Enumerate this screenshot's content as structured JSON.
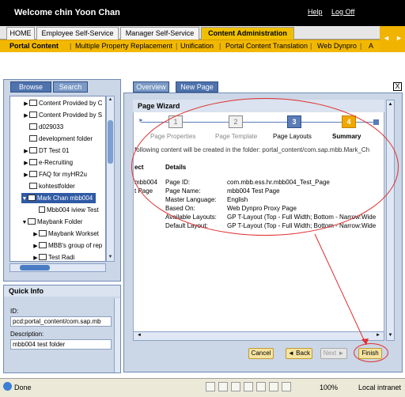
{
  "header": {
    "welcome": "Welcome chin Yoon Chan",
    "help": "Help",
    "logoff": "Log Off"
  },
  "top_tabs": [
    {
      "label": "HOME"
    },
    {
      "label": "Employee Self-Service"
    },
    {
      "label": "Manager Self-Service"
    },
    {
      "label": "Content Administration",
      "active": true
    }
  ],
  "sub_tabs": [
    {
      "label": "Portal Content",
      "active": true
    },
    {
      "label": "Multiple Property Replacement"
    },
    {
      "label": "Unification"
    },
    {
      "label": "Portal Content Translation"
    },
    {
      "label": "Web Dynpro"
    },
    {
      "label": "A"
    }
  ],
  "left": {
    "tabs": [
      {
        "label": "Browse"
      },
      {
        "label": "Search"
      }
    ],
    "tree": [
      {
        "label": "Content Provided by C"
      },
      {
        "label": "Content Provided by S"
      },
      {
        "label": "d029033"
      },
      {
        "label": "development folder"
      },
      {
        "label": "DT Test 01"
      },
      {
        "label": "e-Recruiting"
      },
      {
        "label": "FAQ for myHR2u"
      },
      {
        "label": "kohtestfolder"
      },
      {
        "label": "Mark Chan mbb004"
      },
      {
        "label": "Mbb004 iview Test"
      },
      {
        "label": "Maybank Folder"
      },
      {
        "label": "Maybank Workset"
      },
      {
        "label": "MBB's group of rep"
      },
      {
        "label": "Test Radi"
      }
    ]
  },
  "quick_info": {
    "title": "Quick Info",
    "id_label": "ID:",
    "id_value": "pcd:portal_content/com.sap.mb",
    "desc_label": "Description:",
    "desc_value": "mbb004 test folder"
  },
  "right": {
    "tabs": [
      {
        "label": "Overview"
      },
      {
        "label": "New Page"
      }
    ],
    "close": "X",
    "wizard_title": "Page Wizard",
    "steps": [
      {
        "num": "1",
        "label": "Page Properties"
      },
      {
        "num": "2",
        "label": "Page Template"
      },
      {
        "num": "3",
        "label": "Page Layouts"
      },
      {
        "num": "4",
        "label": "Summary"
      }
    ],
    "intro": "following content will be created in the folder: portal_content/com.sap.mbb.Mark_Ch",
    "col_object": "ect",
    "col_details": "Details",
    "object_lines": [
      "mbb004",
      "t Page"
    ],
    "detail_labels": [
      "Page ID:",
      "Page Name:",
      "Master Language:",
      "Based On:",
      "Available Layouts:",
      "Default Layout:"
    ],
    "detail_values": [
      "com.mbb.ess.hr.mbb004_Test_Page",
      "mbb004 Test Page",
      "English",
      "Web Dynpro Proxy Page",
      "GP T-Layout (Top - Full Width; Bottom - Narrow:Wide",
      "GP T-Layout (Top - Full Width; Bottom - Narrow:Wide"
    ],
    "buttons": {
      "cancel": "Cancel",
      "back": "◄ Back",
      "next": "Next ►",
      "finish": "Finish"
    }
  },
  "status": {
    "done": "Done",
    "zoom": "100%",
    "zone": "Local intranet"
  }
}
